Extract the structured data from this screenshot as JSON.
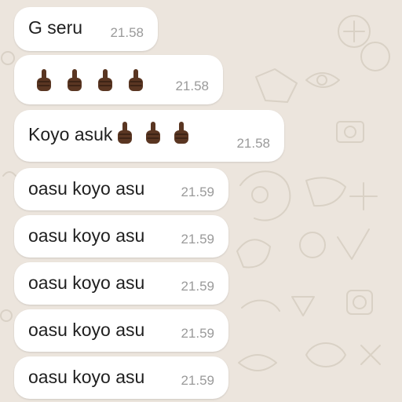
{
  "messages": [
    {
      "text": "G seru",
      "time": "21.58"
    },
    {
      "emojis": [
        "middle-finger-emoji",
        "middle-finger-emoji",
        "middle-finger-emoji",
        "middle-finger-emoji"
      ],
      "time": "21.58"
    },
    {
      "text": "Koyo asuk",
      "emojis": [
        "middle-finger-emoji",
        "middle-finger-emoji",
        "middle-finger-emoji"
      ],
      "time": "21.58"
    },
    {
      "text": "oasu koyo asu",
      "time": "21.59"
    },
    {
      "text": "oasu koyo asu",
      "time": "21.59"
    },
    {
      "text": "oasu koyo asu",
      "time": "21.59"
    },
    {
      "text": "oasu koyo asu",
      "time": "21.59"
    },
    {
      "text": "oasu koyo asu",
      "time": "21.59"
    }
  ],
  "colors": {
    "chat_background": "#ece5dd",
    "bubble": "#ffffff",
    "message_text": "#1f1f1f",
    "timestamp": "#9a9a9a",
    "emoji_skin": "#5a3622"
  }
}
